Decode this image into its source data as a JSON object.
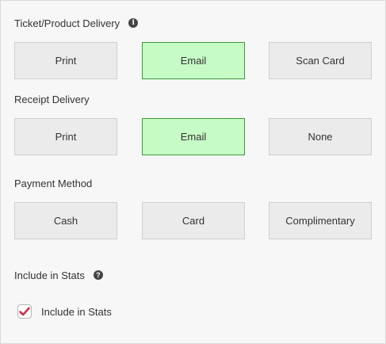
{
  "sections": {
    "ticket": {
      "title": "Ticket/Product Delivery",
      "options": [
        "Print",
        "Email",
        "Scan Card"
      ],
      "selected": "Email"
    },
    "receipt": {
      "title": "Receipt Delivery",
      "options": [
        "Print",
        "Email",
        "None"
      ],
      "selected": "Email"
    },
    "payment": {
      "title": "Payment Method",
      "options": [
        "Cash",
        "Card",
        "Complimentary"
      ],
      "selected": ""
    },
    "stats": {
      "title": "Include in Stats",
      "checkbox_label": "Include in Stats",
      "checked": true
    }
  },
  "icons": {
    "info": "info-circle-icon",
    "help": "question-circle-icon",
    "check": "checkmark-icon"
  },
  "colors": {
    "selected_bg": "#c6fbc6",
    "selected_border": "#3c9a3c",
    "option_bg": "#ebebeb",
    "check_color": "#d0334b"
  }
}
